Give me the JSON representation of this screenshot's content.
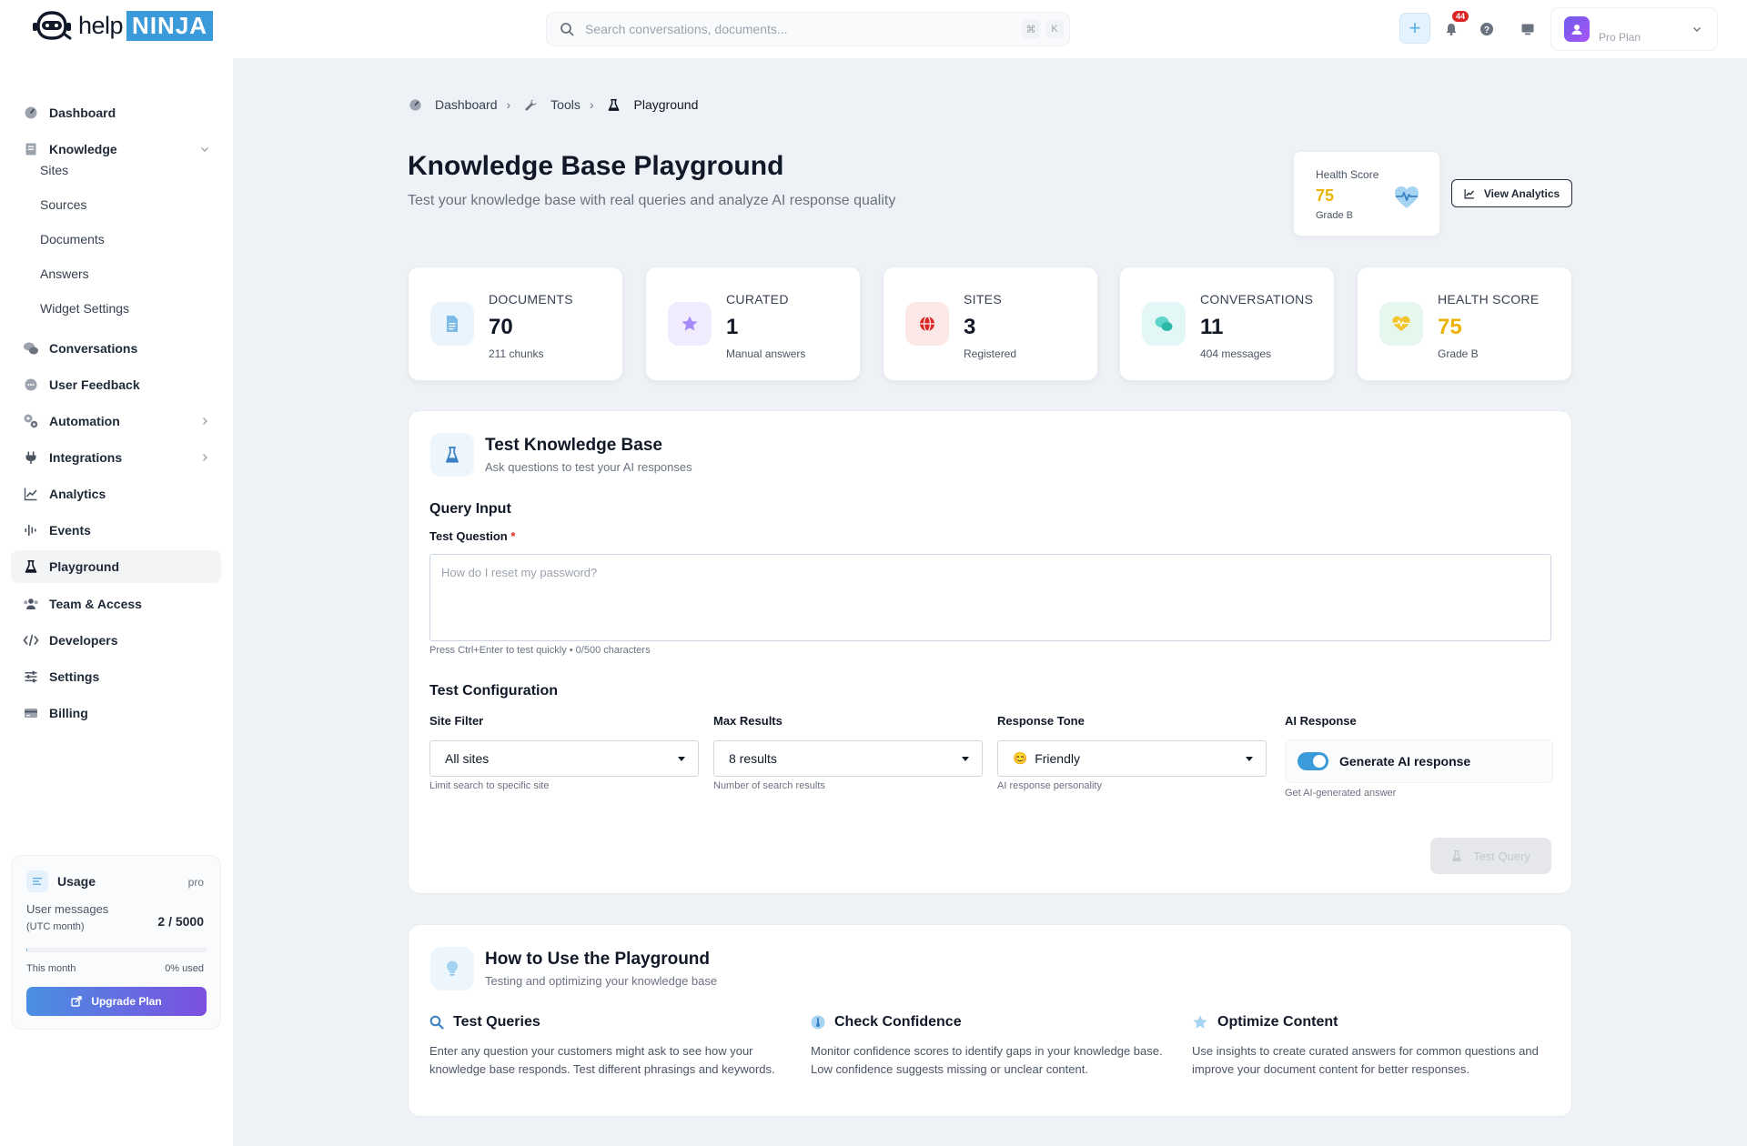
{
  "brand": {
    "help": "help",
    "ninja": "NINJA"
  },
  "search": {
    "placeholder": "Search conversations, documents...",
    "kbd1": "⌘",
    "kbd2": "K"
  },
  "topbar": {
    "notifications": "44",
    "plan": "Pro Plan"
  },
  "sidebar": {
    "items": [
      {
        "label": "Dashboard",
        "icon": "dashboard-icon"
      },
      {
        "label": "Knowledge",
        "icon": "book-icon"
      },
      {
        "label": "Conversations",
        "icon": "chat-bubbles-icon"
      },
      {
        "label": "User Feedback",
        "icon": "feedback-icon"
      },
      {
        "label": "Automation",
        "icon": "gears-icon"
      },
      {
        "label": "Integrations",
        "icon": "plug-icon"
      },
      {
        "label": "Analytics",
        "icon": "chart-line-icon"
      },
      {
        "label": "Events",
        "icon": "wave-icon"
      },
      {
        "label": "Playground",
        "icon": "flask-icon"
      },
      {
        "label": "Team & Access",
        "icon": "users-icon"
      },
      {
        "label": "Developers",
        "icon": "code-icon"
      },
      {
        "label": "Settings",
        "icon": "sliders-icon"
      },
      {
        "label": "Billing",
        "icon": "credit-card-icon"
      }
    ],
    "knowledge_sub": [
      "Sites",
      "Sources",
      "Documents",
      "Answers",
      "Widget Settings"
    ],
    "active": "Playground"
  },
  "usage": {
    "title": "Usage",
    "tier": "pro",
    "label1": "User messages",
    "label2": "(UTC month)",
    "count": "2 / 5000",
    "month": "This month",
    "pct": "0% used",
    "used_fraction": 0.0004,
    "upgrade": "Upgrade Plan"
  },
  "breadcrumb": {
    "b1": "Dashboard",
    "b2": "Tools",
    "b3": "Playground"
  },
  "header": {
    "title": "Knowledge Base Playground",
    "subtitle": "Test your knowledge base with real queries and analyze AI response quality"
  },
  "health": {
    "label": "Health Score",
    "value": "75",
    "grade": "Grade B"
  },
  "view_analytics": "View Analytics",
  "stats": [
    {
      "label": "DOCUMENTS",
      "value": "70",
      "sub": "211 chunks",
      "color": "#3b9ad9"
    },
    {
      "label": "CURATED",
      "value": "1",
      "sub": "Manual answers",
      "color": "#8b5cf6"
    },
    {
      "label": "SITES",
      "value": "3",
      "sub": "Registered",
      "color": "#dc2626"
    },
    {
      "label": "CONVERSATIONS",
      "value": "11",
      "sub": "404 messages",
      "color": "#14b8a6"
    },
    {
      "label": "HEALTH SCORE",
      "value": "75",
      "sub": "Grade B",
      "color": "#eab308"
    }
  ],
  "test_panel": {
    "title": "Test Knowledge Base",
    "subtitle": "Ask questions to test your AI responses",
    "query_section": "Query Input",
    "question_label": "Test Question",
    "required_mark": "*",
    "question_placeholder": "How do I reset my password?",
    "question_hint": "Press Ctrl+Enter to test quickly • 0/500 characters",
    "config_section": "Test Configuration",
    "site_filter_label": "Site Filter",
    "site_filter_value": "All sites",
    "site_filter_hint": "Limit search to specific site",
    "max_results_label": "Max Results",
    "max_results_value": "8 results",
    "max_results_hint": "Number of search results",
    "tone_label": "Response Tone",
    "tone_emoji": "😊",
    "tone_value": "Friendly",
    "tone_hint": "AI response personality",
    "ai_label": "AI Response",
    "ai_toggle_label": "Generate AI response",
    "ai_toggle_on": true,
    "ai_hint": "Get AI-generated answer",
    "test_button": "Test Query"
  },
  "howto": {
    "title": "How to Use the Playground",
    "subtitle": "Testing and optimizing your knowledge base",
    "tips": [
      {
        "title": "Test Queries",
        "icon": "magnifier-icon",
        "text": "Enter any question your customers might ask to see how your knowledge base responds. Test different phrasings and keywords."
      },
      {
        "title": "Check Confidence",
        "icon": "thermometer-icon",
        "text": "Monitor confidence scores to identify gaps in your knowledge base. Low confidence suggests missing or unclear content."
      },
      {
        "title": "Optimize Content",
        "icon": "star-icon",
        "text": "Use insights to create curated answers for common questions and improve your document content for better responses."
      }
    ]
  }
}
